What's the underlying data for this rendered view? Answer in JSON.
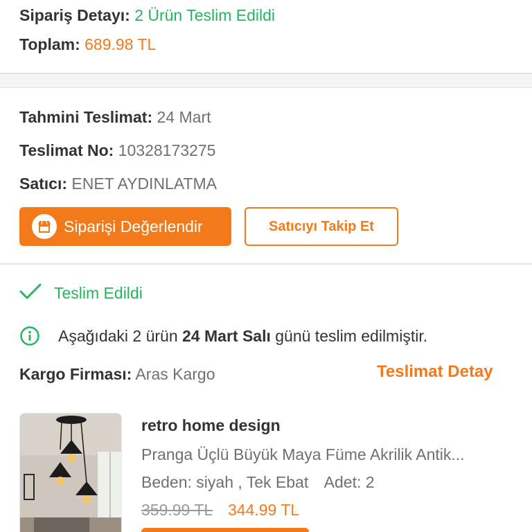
{
  "summary": {
    "detail_label": "Sipariş Detayı:",
    "detail_value": "2 Ürün Teslim Edildi",
    "total_label": "Toplam:",
    "total_value": "689.98 TL"
  },
  "delivery": {
    "eta_label": "Tahmini Teslimat:",
    "eta_value": "24 Mart",
    "number_label": "Teslimat No:",
    "number_value": "10328173275",
    "seller_label": "Satıcı:",
    "seller_value": "ENET AYDINLATMA"
  },
  "actions": {
    "rate_order": "Siparişi Değerlendir",
    "follow_seller": "Satıcıyı Takip Et"
  },
  "status": {
    "label": "Teslim Edildi",
    "info_prefix": "Aşağıdaki 2 ürün ",
    "info_bold": "24 Mart Salı",
    "info_suffix": " günü teslim edilmiştir."
  },
  "cargo": {
    "label": "Kargo Firması:",
    "value": "Aras Kargo",
    "detail_link": "Teslimat Detay"
  },
  "product": {
    "brand": "retro home design",
    "name": "Pranga Üçlü Büyük Maya Füme Akrilik Antik...",
    "size_label": "Beden:",
    "size_value": "siyah , Tek Ebat",
    "qty_label": "Adet:",
    "qty_value": "2",
    "old_price": "359.99 TL",
    "new_price": "344.99 TL"
  },
  "colors": {
    "accent": "#f27a1a",
    "success": "#25b55f",
    "text": "#333333",
    "muted": "#707070"
  },
  "icons": {
    "rate": "store-icon",
    "status": "check-icon",
    "info": "info-circle-icon"
  }
}
